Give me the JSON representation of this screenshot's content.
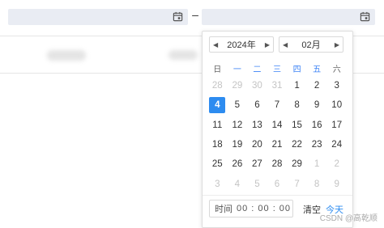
{
  "range": {
    "separator": "–"
  },
  "calendar": {
    "year_label": "2024年",
    "month_label": "02月",
    "weekdays": [
      "日",
      "一",
      "二",
      "三",
      "四",
      "五",
      "六"
    ],
    "weeks": [
      [
        {
          "d": "28",
          "m": true
        },
        {
          "d": "29",
          "m": true
        },
        {
          "d": "30",
          "m": true
        },
        {
          "d": "31",
          "m": true
        },
        {
          "d": "1"
        },
        {
          "d": "2"
        },
        {
          "d": "3"
        }
      ],
      [
        {
          "d": "4",
          "s": true
        },
        {
          "d": "5"
        },
        {
          "d": "6"
        },
        {
          "d": "7"
        },
        {
          "d": "8"
        },
        {
          "d": "9"
        },
        {
          "d": "10"
        }
      ],
      [
        {
          "d": "11"
        },
        {
          "d": "12"
        },
        {
          "d": "13"
        },
        {
          "d": "14"
        },
        {
          "d": "15"
        },
        {
          "d": "16"
        },
        {
          "d": "17"
        }
      ],
      [
        {
          "d": "18"
        },
        {
          "d": "19"
        },
        {
          "d": "20"
        },
        {
          "d": "21"
        },
        {
          "d": "22"
        },
        {
          "d": "23"
        },
        {
          "d": "24"
        }
      ],
      [
        {
          "d": "25"
        },
        {
          "d": "26"
        },
        {
          "d": "27"
        },
        {
          "d": "28"
        },
        {
          "d": "29"
        },
        {
          "d": "1",
          "m": true
        },
        {
          "d": "2",
          "m": true
        }
      ],
      [
        {
          "d": "3",
          "m": true
        },
        {
          "d": "4",
          "m": true
        },
        {
          "d": "5",
          "m": true
        },
        {
          "d": "6",
          "m": true
        },
        {
          "d": "7",
          "m": true
        },
        {
          "d": "8",
          "m": true
        },
        {
          "d": "9",
          "m": true
        }
      ]
    ],
    "time_label": "时间",
    "time_value": "00 : 00 : 00",
    "clear_label": "清空",
    "today_label": "今天"
  },
  "watermark": "CSDN @高乾顺",
  "colors": {
    "accent": "#2d8cf0",
    "weekday_blue": "#3b82f6",
    "field_bg": "#e9ecf3"
  }
}
